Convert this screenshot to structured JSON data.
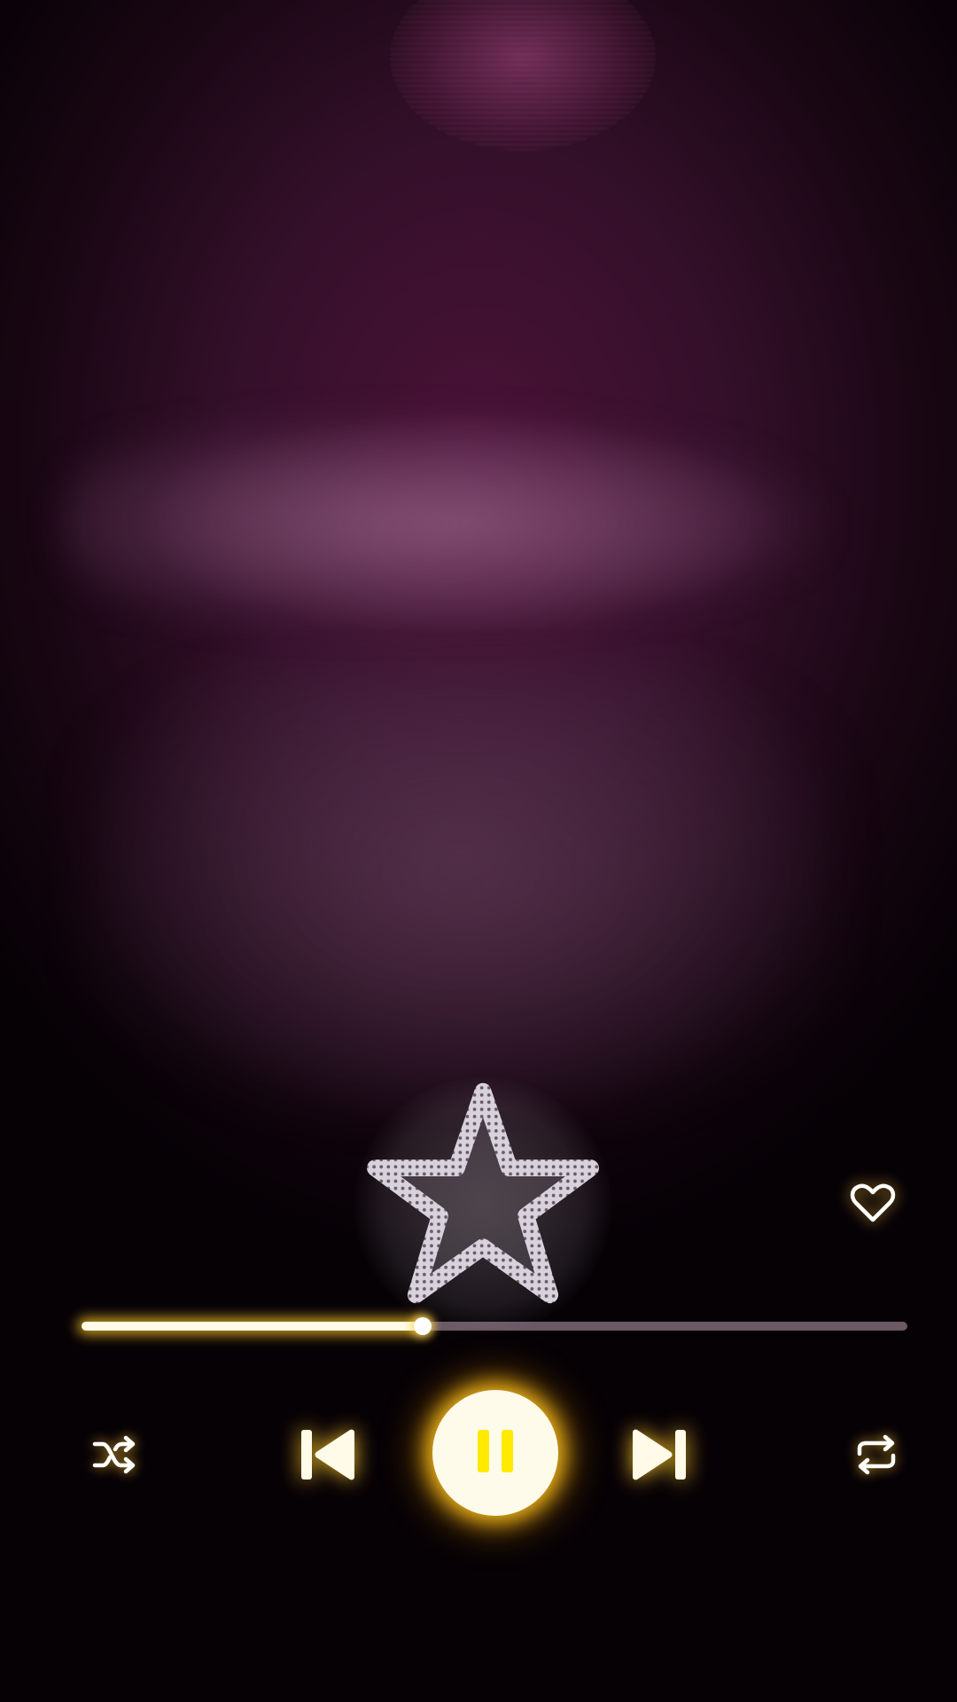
{
  "player": {
    "progress_fraction": 0.413,
    "is_playing": true,
    "liked": false,
    "accent_color": "#ffea00",
    "glow_color": "#ffc21e",
    "icons": {
      "rating": "star-outline-icon",
      "like": "heart-outline-icon",
      "shuffle": "shuffle-icon",
      "previous": "skip-previous-icon",
      "play_pause": "pause-icon",
      "next": "skip-next-icon",
      "repeat": "repeat-icon"
    }
  }
}
